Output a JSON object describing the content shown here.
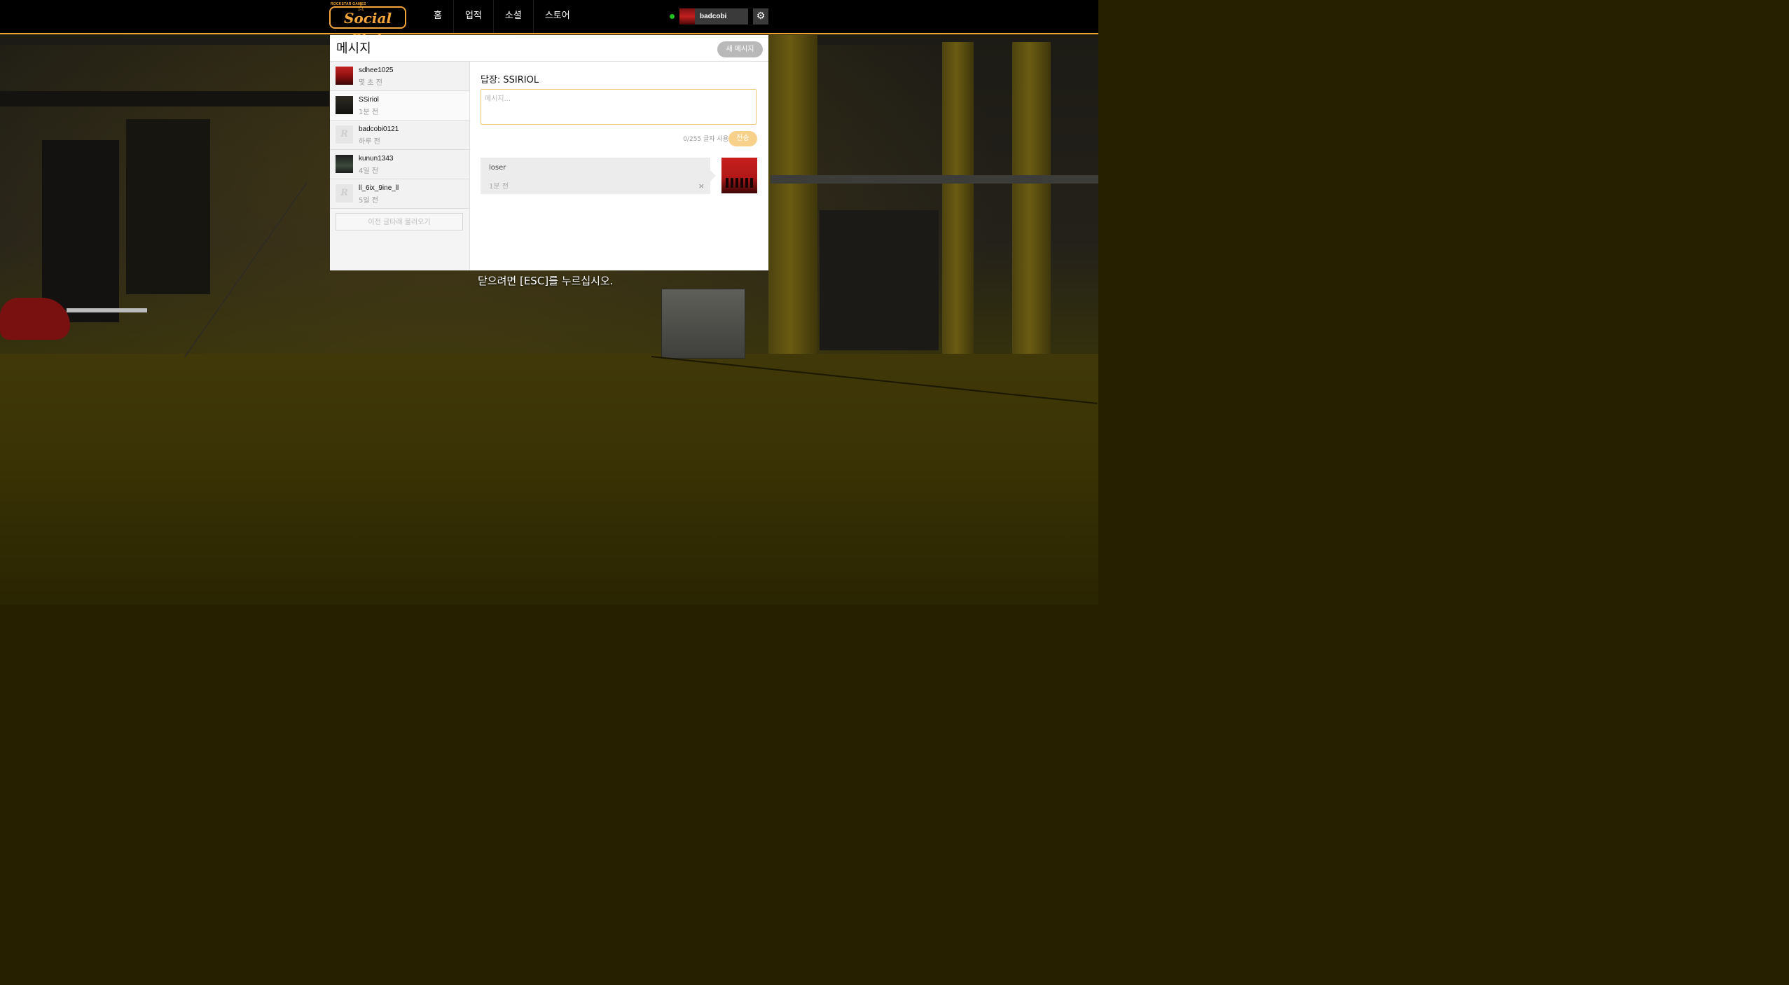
{
  "header": {
    "logo_small": "ROCKSTAR GAMES",
    "logo_main": "Social Club",
    "nav": [
      {
        "label": "홈"
      },
      {
        "label": "업적"
      },
      {
        "label": "소셜"
      },
      {
        "label": "스토어"
      }
    ],
    "username": "badcobi",
    "status_color": "#1fc11f",
    "settings_icon": "gear-icon"
  },
  "messages": {
    "title": "메시지",
    "new_message_label": "새 메시지",
    "conversations": [
      {
        "name": "sdhee1025",
        "time": "몇 초 전",
        "avatar": "rdr-avatar"
      },
      {
        "name": "SSiriol",
        "time": "1분 전",
        "avatar": "dark-avatar"
      },
      {
        "name": "badcobi0121",
        "time": "하루 전",
        "avatar": "default-avatar"
      },
      {
        "name": "kunun1343",
        "time": "4일 전",
        "avatar": "gta-avatar"
      },
      {
        "name": "ll_6ix_9ine_ll",
        "time": "5일 전",
        "avatar": "default-avatar"
      }
    ],
    "load_more_label": "이전 글타래 불러오기",
    "reply": {
      "title": "답장: SSIRIOL",
      "placeholder": "메시지...",
      "char_count": "0/255 글자 사용",
      "send_label": "전송"
    },
    "thread": [
      {
        "text": "loser",
        "time": "1분 전",
        "delete": "×"
      }
    ]
  },
  "esc_hint": "닫으려면 [ESC]를 누르십시오.",
  "colors": {
    "accent": "#f0a430",
    "send_button": "#f7d08a",
    "new_message_button": "#b9b9b9"
  }
}
